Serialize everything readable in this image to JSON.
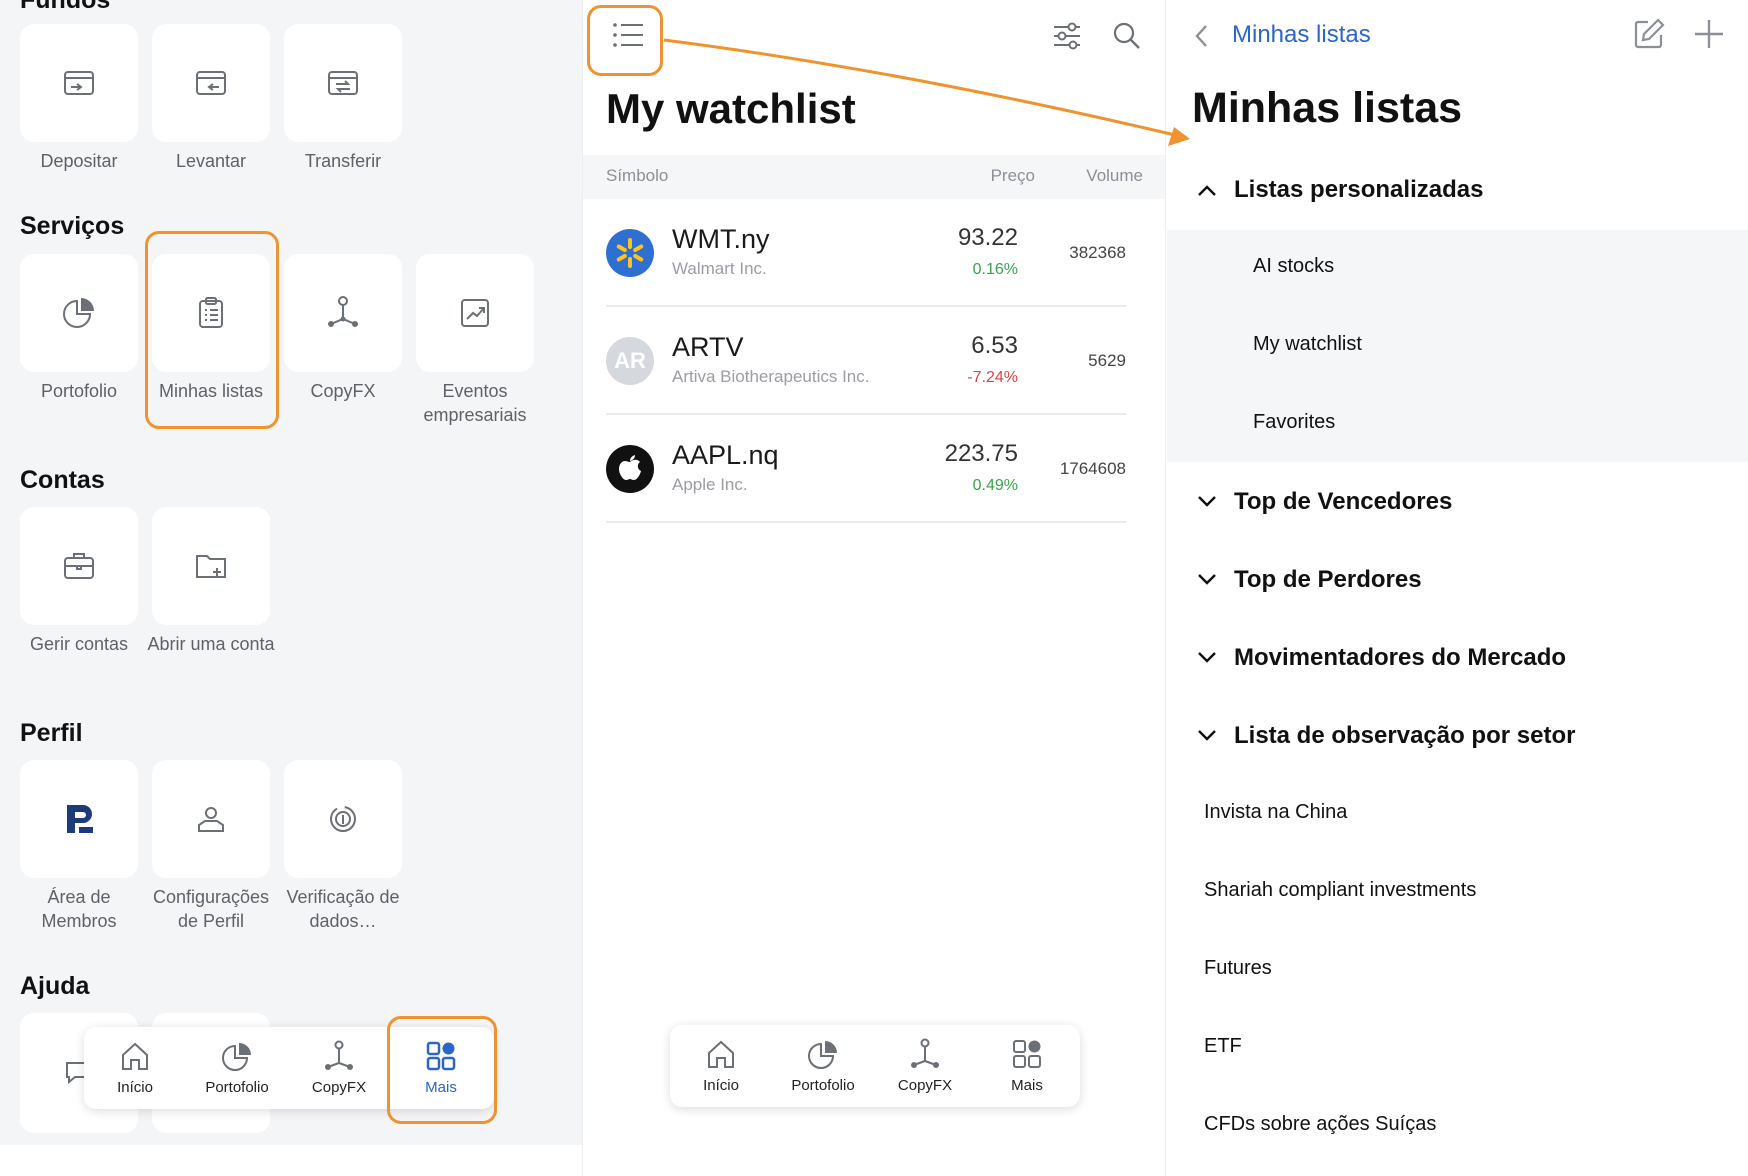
{
  "left_panel": {
    "top_section_cut_title": "Fundos",
    "funds": [
      {
        "label": "Depositar",
        "icon": "wallet-in-icon"
      },
      {
        "label": "Levantar",
        "icon": "wallet-out-icon"
      },
      {
        "label": "Transferir",
        "icon": "wallet-transfer-icon"
      }
    ],
    "services_title": "Serviços",
    "services": [
      {
        "label": "Portofolio",
        "icon": "pie-chart-icon"
      },
      {
        "label": "Minhas listas",
        "icon": "clipboard-list-icon"
      },
      {
        "label": "CopyFX",
        "icon": "network-icon"
      },
      {
        "label": "Eventos empresariais",
        "icon": "chart-frame-icon"
      }
    ],
    "accounts_title": "Contas",
    "accounts": [
      {
        "label": "Gerir contas",
        "icon": "briefcase-icon"
      },
      {
        "label": "Abrir uma conta",
        "icon": "folder-plus-icon"
      }
    ],
    "profile_title": "Perfil",
    "profile": [
      {
        "label": "Área de Membros",
        "icon": "brand-logo-icon"
      },
      {
        "label": "Configurações de Perfil",
        "icon": "user-settings-icon"
      },
      {
        "label": "Verificação de dados…",
        "icon": "fingerprint-icon"
      }
    ],
    "help_title": "Ajuda",
    "bottom_nav": [
      {
        "label": "Início",
        "icon": "home-icon"
      },
      {
        "label": "Portofolio",
        "icon": "pie-chart-icon"
      },
      {
        "label": "CopyFX",
        "icon": "network-icon"
      },
      {
        "label": "Mais",
        "icon": "grid-icon",
        "active": true
      }
    ]
  },
  "watchlist": {
    "title": "My watchlist",
    "columns": {
      "symbol": "Símbolo",
      "price": "Preço",
      "volume": "Volume"
    },
    "rows": [
      {
        "symbol": "WMT.ny",
        "name": "Walmart Inc.",
        "price": "93.22",
        "change": "0.16%",
        "volume": "382368",
        "logo": "walmart-logo-icon"
      },
      {
        "symbol": "ARTV",
        "name": "Artiva Biotherapeutics Inc.",
        "price": "6.53",
        "change": "-7.24%",
        "volume": "5629",
        "logo": "AR"
      },
      {
        "symbol": "AAPL.nq",
        "name": "Apple Inc.",
        "price": "223.75",
        "change": "0.49%",
        "volume": "1764608",
        "logo": "apple-logo-icon"
      }
    ],
    "bottom_nav": [
      {
        "label": "Início",
        "icon": "home-icon"
      },
      {
        "label": "Portofolio",
        "icon": "pie-chart-icon"
      },
      {
        "label": "CopyFX",
        "icon": "network-icon"
      },
      {
        "label": "Mais",
        "icon": "grid-icon"
      }
    ]
  },
  "lists_panel": {
    "back_label": "Minhas listas",
    "title": "Minhas listas",
    "custom_group": "Listas personalizadas",
    "custom_lists": [
      "AI stocks",
      "My watchlist",
      "Favorites"
    ],
    "groups": [
      "Top de Vencedores",
      "Top de Perdores",
      "Movimentadores do Mercado",
      "Lista de observação por setor"
    ],
    "plain_lists": [
      "Invista na China",
      "Shariah compliant investments",
      "Futures",
      "ETF",
      "CFDs sobre ações Suíças"
    ]
  },
  "colors": {
    "accent_blue": "#2a66c9",
    "highlight_orange": "#f0922e",
    "positive_green": "#3aa34a",
    "negative_red": "#d64545"
  }
}
